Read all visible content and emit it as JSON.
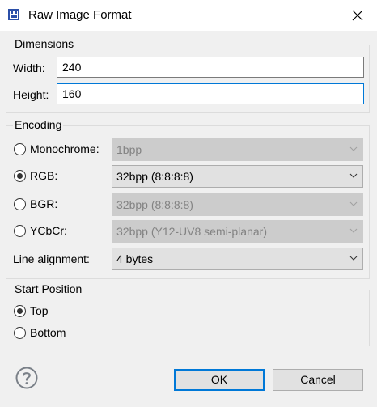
{
  "window": {
    "title": "Raw Image Format",
    "app_icon": "raw-image-icon",
    "close_icon": "close-icon"
  },
  "dimensions": {
    "group_label": "Dimensions",
    "width": {
      "label": "Width:",
      "value": "240"
    },
    "height": {
      "label": "Height:",
      "value": "160"
    }
  },
  "encoding": {
    "group_label": "Encoding",
    "options": [
      {
        "label": "Monochrome:",
        "checked": false,
        "format": "1bpp",
        "enabled": false
      },
      {
        "label": "RGB:",
        "checked": true,
        "format": "32bpp (8:8:8:8)",
        "enabled": true
      },
      {
        "label": "BGR:",
        "checked": false,
        "format": "32bpp (8:8:8:8)",
        "enabled": false
      },
      {
        "label": "YCbCr:",
        "checked": false,
        "format": "32bpp (Y12-UV8 semi-planar)",
        "enabled": false
      }
    ],
    "line_alignment": {
      "label": "Line alignment:",
      "value": "4 bytes"
    }
  },
  "start_position": {
    "group_label": "Start Position",
    "options": [
      {
        "label": "Top",
        "checked": true
      },
      {
        "label": "Bottom",
        "checked": false
      }
    ]
  },
  "buttons": {
    "ok": "OK",
    "cancel": "Cancel",
    "help_icon": "help-icon"
  },
  "colors": {
    "focus_border": "#0078d7",
    "dialog_bg": "#f0f0f0",
    "disabled_fill": "#cccccc"
  }
}
